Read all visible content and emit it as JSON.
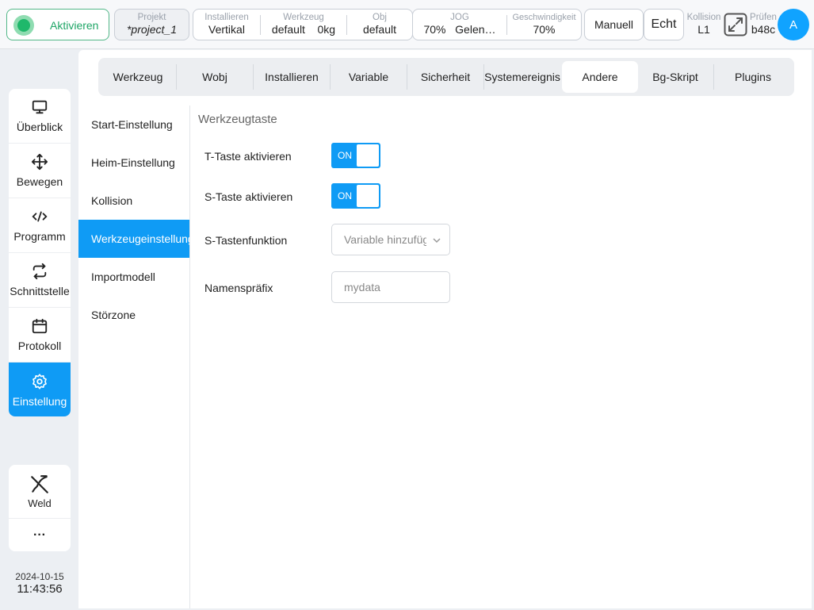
{
  "topbar": {
    "activate_label": "Aktivieren",
    "project": {
      "label": "Projekt",
      "value": "*project_1"
    },
    "install_group": [
      {
        "label": "Installieren",
        "value": "Vertikal"
      },
      {
        "label": "Werkzeug",
        "value": "default    0kg"
      },
      {
        "label": "Obj",
        "value": "default"
      }
    ],
    "motion_group": [
      {
        "label": "JOG",
        "value": "70%   Gelen…"
      },
      {
        "label": "Geschwindigkeit",
        "value": "70%"
      }
    ],
    "manual_label": "Manuell",
    "real_label": "Echt",
    "collision": {
      "label": "Kollision",
      "value": "L1"
    },
    "check": {
      "label": "Prüfen",
      "value": "b48c"
    },
    "avatar_letter": "A"
  },
  "nav": {
    "items": [
      {
        "label": "Überblick",
        "icon": "monitor-icon"
      },
      {
        "label": "Bewegen",
        "icon": "move-icon"
      },
      {
        "label": "Programm",
        "icon": "code-icon"
      },
      {
        "label": "Schnittstelle",
        "icon": "swap-icon"
      },
      {
        "label": "Protokoll",
        "icon": "calendar-icon"
      },
      {
        "label": "Einstellung",
        "icon": "gear-icon"
      }
    ],
    "weld_label": "Weld",
    "more_label": "···"
  },
  "datetime": {
    "date": "2024-10-15",
    "time": "11:43:56"
  },
  "tabs": [
    "Werkzeug",
    "Wobj",
    "Installieren",
    "Variable",
    "Sicherheit",
    "Systemereignis",
    "Andere",
    "Bg-Skript",
    "Plugins"
  ],
  "active_tab": "Andere",
  "subnav": [
    "Start-Einstellung",
    "Heim-Einstellung",
    "Kollision",
    "Werkzeugeinstellung",
    "Importmodell",
    "Störzone"
  ],
  "active_subnav": "Werkzeugeinstellung",
  "content": {
    "section_title": "Werkzeugtaste",
    "t_key": {
      "label": "T-Taste aktivieren",
      "state": "ON"
    },
    "s_key": {
      "label": "S-Taste aktivieren",
      "state": "ON"
    },
    "s_function": {
      "label": "S-Tastenfunktion",
      "value": "Variable hinzufügen"
    },
    "name_prefix": {
      "label": "Namenspräfix",
      "value": "mydata"
    }
  },
  "colors": {
    "accent": "#0f9bf5",
    "active_green": "#1fb86b"
  }
}
